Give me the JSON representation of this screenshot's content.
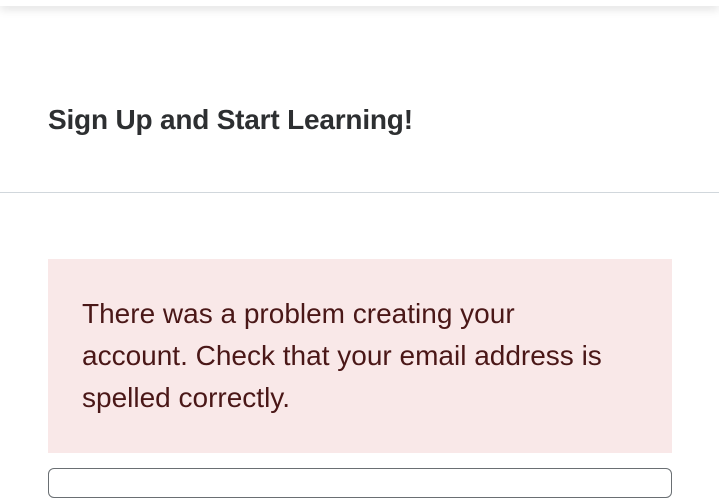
{
  "modal": {
    "title": "Sign Up and Start Learning!"
  },
  "alert": {
    "message": "There was a problem creating your account. Check that your email address is spelled correctly."
  },
  "colors": {
    "title": "#2d2f31",
    "alert_background": "#f9e8e8",
    "alert_text": "#4a1717",
    "divider": "#d1d7dc"
  }
}
